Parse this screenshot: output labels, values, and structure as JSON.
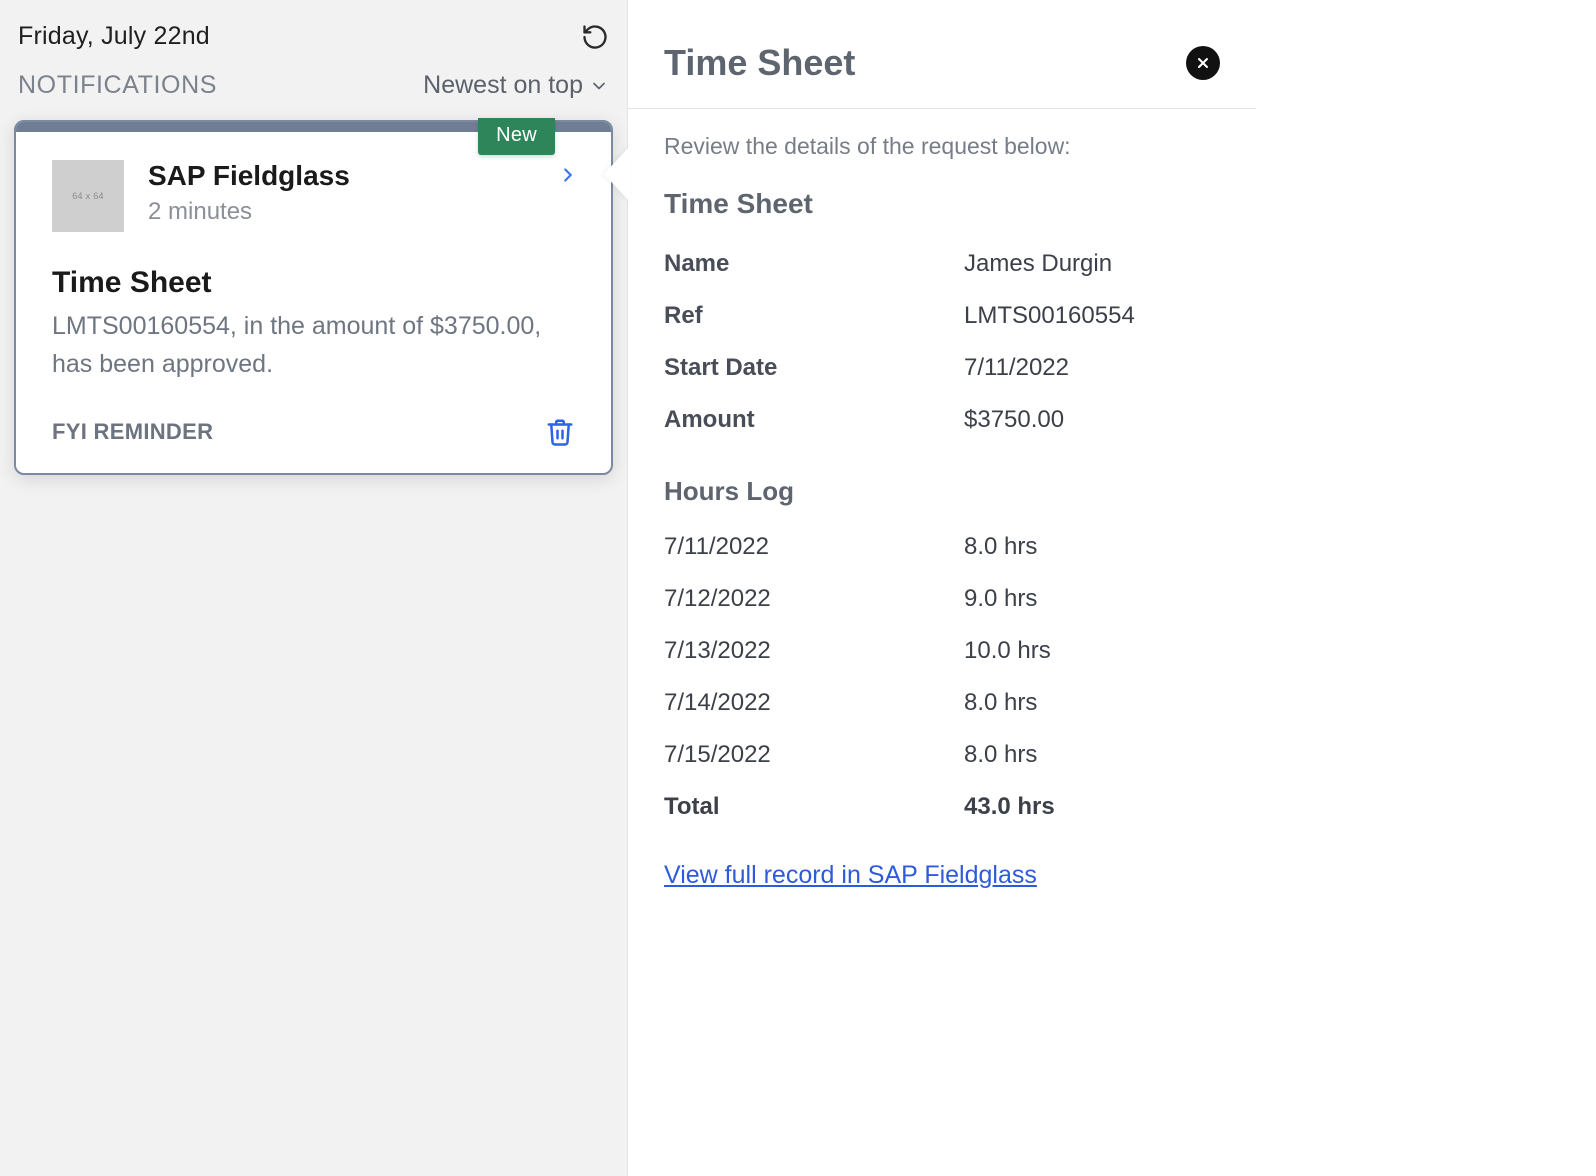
{
  "left": {
    "date": "Friday, July 22nd",
    "notifications_label": "NOTIFICATIONS",
    "sort_label": "Newest on top"
  },
  "card": {
    "badge": "New",
    "logo_placeholder": "64 x 64",
    "app_name": "SAP Fieldglass",
    "time_ago": "2 minutes",
    "title": "Time Sheet",
    "description": "LMTS00160554, in the amount of $3750.00, has been approved.",
    "fyi": "FYI REMINDER"
  },
  "detail": {
    "title": "Time Sheet",
    "review_text": "Review the details of the request below:",
    "section_title": "Time Sheet",
    "fields": {
      "name_label": "Name",
      "name_value": "James Durgin",
      "ref_label": "Ref",
      "ref_value": "LMTS00160554",
      "start_label": "Start Date",
      "start_value": "7/11/2022",
      "amount_label": "Amount",
      "amount_value": "$3750.00"
    },
    "hours_title": "Hours Log",
    "hours": [
      {
        "date": "7/11/2022",
        "hours": "8.0 hrs"
      },
      {
        "date": "7/12/2022",
        "hours": "9.0 hrs"
      },
      {
        "date": "7/13/2022",
        "hours": "10.0 hrs"
      },
      {
        "date": "7/14/2022",
        "hours": "8.0 hrs"
      },
      {
        "date": "7/15/2022",
        "hours": "8.0 hrs"
      }
    ],
    "total_label": "Total",
    "total_value": "43.0 hrs",
    "link_text": "View full record in SAP Fieldglass"
  }
}
